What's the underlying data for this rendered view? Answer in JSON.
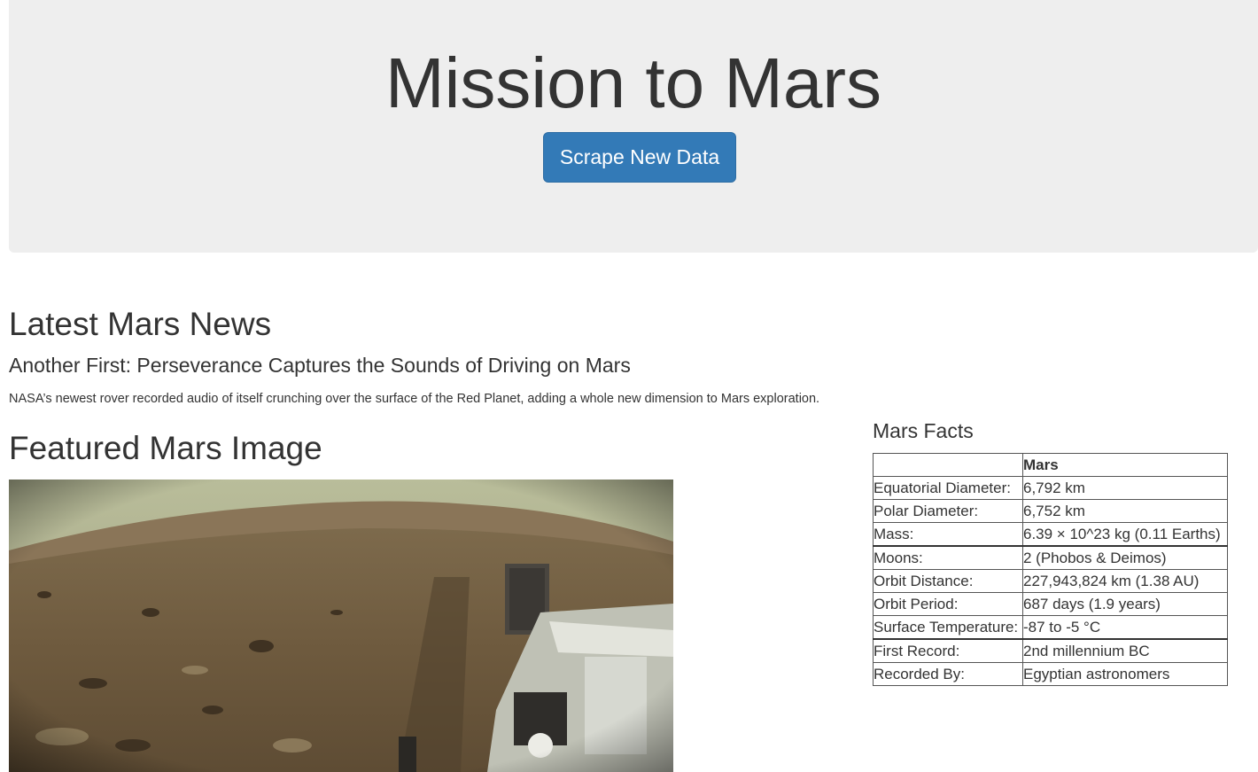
{
  "header": {
    "title": "Mission to Mars",
    "scrape_button_label": "Scrape New Data"
  },
  "news": {
    "heading": "Latest Mars News",
    "title": "Another First: Perseverance Captures the Sounds of Driving on Mars",
    "paragraph": "NASA’s newest rover recorded audio of itself crunching over the surface of the Red Planet, adding a whole new dimension to Mars exploration."
  },
  "featured": {
    "heading": "Featured Mars Image"
  },
  "facts": {
    "heading": "Mars Facts",
    "column_header": "Mars",
    "rows": [
      {
        "label": "Equatorial Diameter:",
        "value": "6,792 km"
      },
      {
        "label": "Polar Diameter:",
        "value": "6,752 km"
      },
      {
        "label": "Mass:",
        "value": "6.39 × 10^23 kg (0.11 Earths)"
      },
      {
        "label": "Moons:",
        "value": "2 (Phobos & Deimos)"
      },
      {
        "label": "Orbit Distance:",
        "value": "227,943,824 km (1.38 AU)"
      },
      {
        "label": "Orbit Period:",
        "value": "687 days (1.9 years)"
      },
      {
        "label": "Surface Temperature:",
        "value": "-87 to -5 °C"
      },
      {
        "label": "First Record:",
        "value": "2nd millennium BC"
      },
      {
        "label": "Recorded By:",
        "value": "Egyptian astronomers"
      }
    ]
  }
}
